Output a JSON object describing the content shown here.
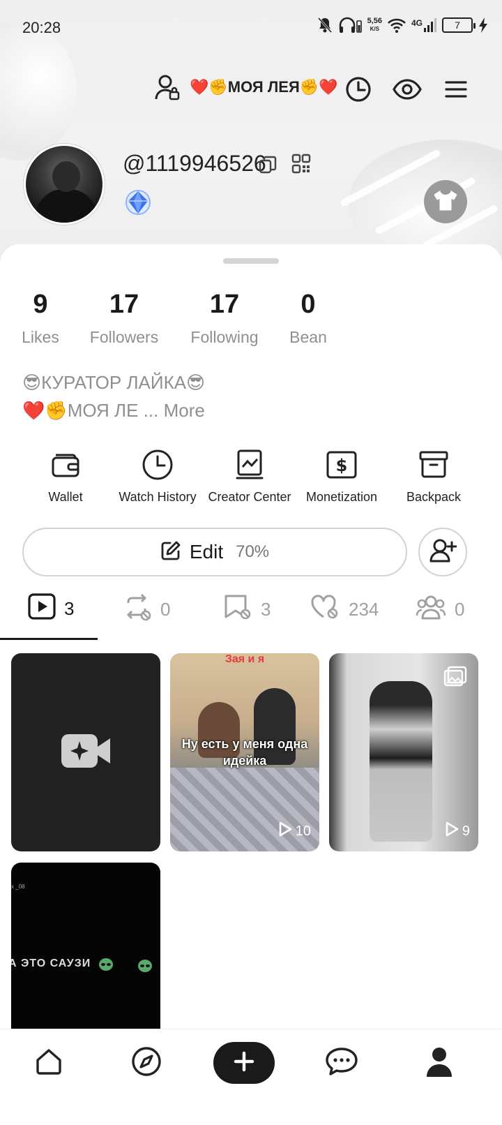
{
  "status": {
    "time": "20:28",
    "net_speed": "5,56",
    "net_unit": "K/S",
    "network": "4G",
    "battery": "7"
  },
  "topbar": {
    "display_name": "❤️✊МОЯ ЛЕЯ✊❤️"
  },
  "profile": {
    "handle": "@1119946526"
  },
  "stats": [
    {
      "value": "9",
      "label": "Likes"
    },
    {
      "value": "17",
      "label": "Followers"
    },
    {
      "value": "17",
      "label": "Following"
    },
    {
      "value": "0",
      "label": "Bean"
    }
  ],
  "bio": {
    "line1": "😎КУРАТОР ЛАЙКА😎",
    "line2": "❤️✊МОЯ ЛЕ ... ",
    "more": "More"
  },
  "tools": [
    {
      "label": "Wallet",
      "icon": "wallet-icon"
    },
    {
      "label": "Watch History",
      "icon": "clock-icon"
    },
    {
      "label": "Creator Center",
      "icon": "chart-icon"
    },
    {
      "label": "Monetization",
      "icon": "dollar-icon"
    },
    {
      "label": "Backpack",
      "icon": "box-icon"
    }
  ],
  "edit": {
    "label": "Edit",
    "progress": "70%"
  },
  "tabs": [
    {
      "count": "3",
      "icon": "video-tab-icon",
      "active": true
    },
    {
      "count": "0",
      "icon": "repost-hidden-icon"
    },
    {
      "count": "3",
      "icon": "bookmark-hidden-icon"
    },
    {
      "count": "234",
      "icon": "heart-hidden-icon"
    },
    {
      "count": "0",
      "icon": "group-icon"
    }
  ],
  "grid": {
    "video1_top_caption": "Зая и я",
    "video1_caption": "Ну есть у меня одна идейка",
    "video1_plays": "10",
    "video2_plays": "9",
    "video3_caption": "А ЭТО САУЗИ",
    "video3_mark": "x\n_08"
  },
  "colors": {
    "accent": "#1a1a1a",
    "muted_text": "#8f8f8f",
    "heart": "#e02020"
  }
}
